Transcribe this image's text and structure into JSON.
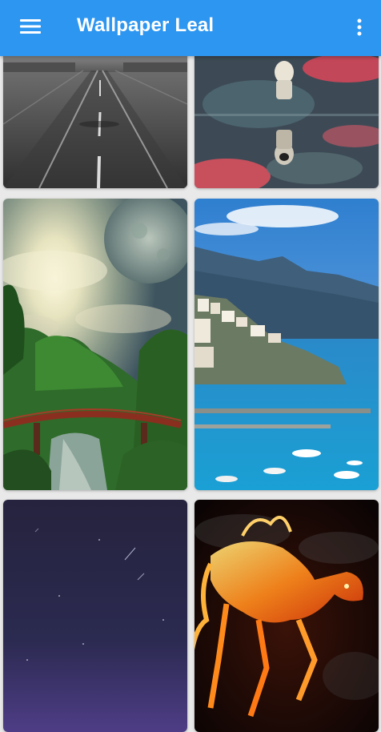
{
  "app_bar": {
    "title": "Wallpaper Leal",
    "menu_icon": "hamburger-menu-icon",
    "overflow_icon": "more-vert-icon",
    "color": "#2d96f0"
  },
  "wallpapers": [
    {
      "subject": "wet-road"
    },
    {
      "subject": "astronaut-reflection"
    },
    {
      "subject": "moon-bridge-forest"
    },
    {
      "subject": "coastal-town-sea"
    },
    {
      "subject": "night-sky-meteors"
    },
    {
      "subject": "fire-horse"
    }
  ]
}
